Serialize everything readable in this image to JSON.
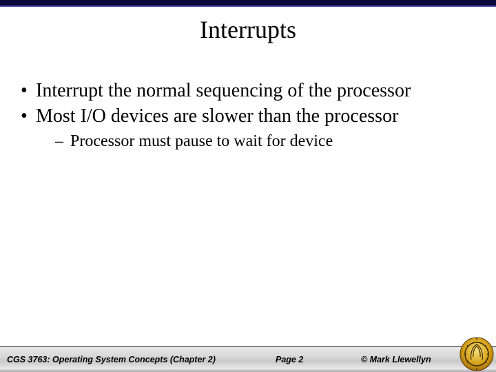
{
  "title": "Interrupts",
  "bullets": {
    "b1": "Interrupt the normal sequencing of the processor",
    "b2": "Most I/O devices are slower than the processor",
    "b2_sub1": "Processor must pause to wait for device"
  },
  "footer": {
    "course": "CGS 3763: Operating System Concepts  (Chapter 2)",
    "page": "Page 2",
    "copyright": "© Mark Llewellyn"
  }
}
